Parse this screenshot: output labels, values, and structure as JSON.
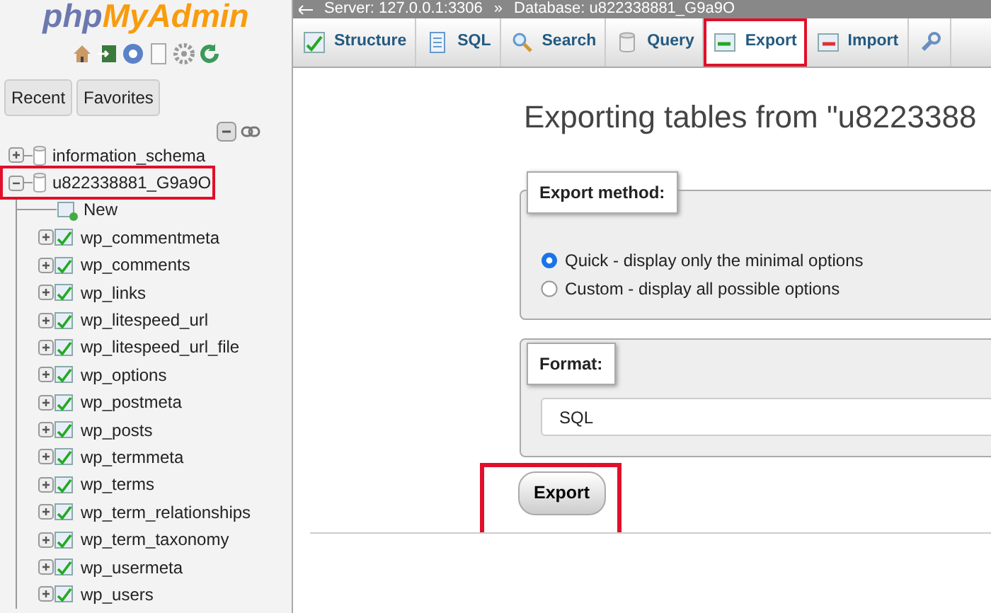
{
  "logo": {
    "part_1": "php",
    "part_2": "MyAdmin"
  },
  "sidebar_tabs": [
    {
      "label": "Recent"
    },
    {
      "label": "Favorites"
    }
  ],
  "tree": [
    {
      "label": "information_schema",
      "expanded": false,
      "highlighted": false
    },
    {
      "label": "u822338881_G9a9O",
      "expanded": true,
      "highlighted": true,
      "children": [
        {
          "kind": "new",
          "label": "New"
        },
        {
          "kind": "table",
          "label": "wp_commentmeta",
          "expanded": false
        },
        {
          "kind": "table",
          "label": "wp_comments",
          "expanded": false
        },
        {
          "kind": "table",
          "label": "wp_links",
          "expanded": false
        },
        {
          "kind": "table",
          "label": "wp_litespeed_url",
          "expanded": false
        },
        {
          "kind": "table",
          "label": "wp_litespeed_url_file",
          "expanded": false
        },
        {
          "kind": "table",
          "label": "wp_options",
          "expanded": false
        },
        {
          "kind": "table",
          "label": "wp_postmeta",
          "expanded": false
        },
        {
          "kind": "table",
          "label": "wp_posts",
          "expanded": false
        },
        {
          "kind": "table",
          "label": "wp_termmeta",
          "expanded": false
        },
        {
          "kind": "table",
          "label": "wp_terms",
          "expanded": false
        },
        {
          "kind": "table",
          "label": "wp_term_relationships",
          "expanded": false
        },
        {
          "kind": "table",
          "label": "wp_term_taxonomy",
          "expanded": false
        },
        {
          "kind": "table",
          "label": "wp_usermeta",
          "expanded": false
        },
        {
          "kind": "table",
          "label": "wp_users",
          "expanded": false
        }
      ]
    }
  ],
  "breadcrumb": {
    "server": "Server: 127.0.0.1:3306",
    "separator": "»",
    "database": "Database: u822338881_G9a9O"
  },
  "tabs": [
    {
      "kind": "structure",
      "label": "Structure",
      "selected": false,
      "highlighted": false
    },
    {
      "kind": "sql",
      "label": "SQL",
      "selected": false,
      "highlighted": false
    },
    {
      "kind": "search",
      "label": "Search",
      "selected": false,
      "highlighted": false
    },
    {
      "kind": "query",
      "label": "Query",
      "selected": false,
      "highlighted": false
    },
    {
      "kind": "export",
      "label": "Export",
      "selected": true,
      "highlighted": true
    },
    {
      "kind": "import",
      "label": "Import",
      "selected": false,
      "highlighted": false
    },
    {
      "kind": "operations",
      "selected": false,
      "highlighted": false
    }
  ],
  "heading": "Exporting tables from \"u8223388",
  "export_method": {
    "legend": "Export method:",
    "options": [
      {
        "label": "Quick - display only the minimal options",
        "selected": true
      },
      {
        "label": "Custom - display all possible options",
        "selected": false
      }
    ]
  },
  "format": {
    "legend": "Format:",
    "value": "SQL"
  },
  "submit": {
    "label": "Export",
    "highlighted": true
  }
}
